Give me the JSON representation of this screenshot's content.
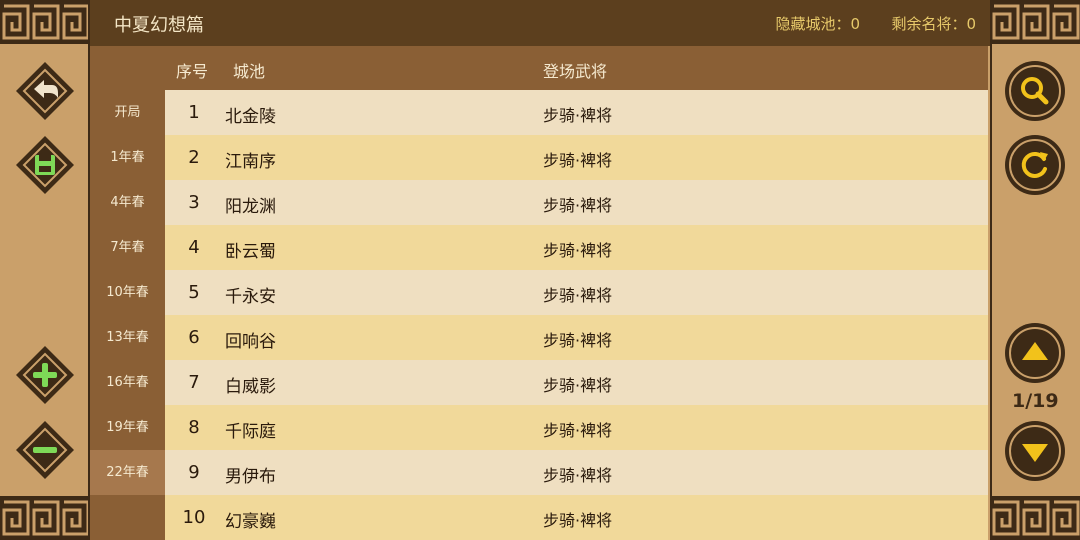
{
  "header": {
    "title": "中夏幻想篇",
    "hidden_cities": "隐藏城池：0",
    "remaining_generals": "剩余名将：0"
  },
  "table": {
    "columns": [
      "序号",
      "城池",
      "登场武将"
    ],
    "rows": [
      {
        "season": "开局",
        "num": "1",
        "city": "北金陵",
        "generals": "步骑·裨将"
      },
      {
        "season": "1年春",
        "num": "2",
        "city": "江南序",
        "generals": "步骑·裨将"
      },
      {
        "season": "4年春",
        "num": "3",
        "city": "阳龙渊",
        "generals": "步骑·裨将"
      },
      {
        "season": "7年春",
        "num": "4",
        "city": "卧云蜀",
        "generals": "步骑·裨将"
      },
      {
        "season": "10年春",
        "num": "5",
        "city": "千永安",
        "generals": "步骑·裨将"
      },
      {
        "season": "13年春",
        "num": "6",
        "city": "回响谷",
        "generals": "步骑·裨将"
      },
      {
        "season": "16年春",
        "num": "7",
        "city": "白威影",
        "generals": "步骑·裨将"
      },
      {
        "season": "19年春",
        "num": "8",
        "city": "千际庭",
        "generals": "步骑·裨将"
      },
      {
        "season": "22年春",
        "num": "9",
        "city": "男伊布",
        "generals": "步骑·裨将"
      },
      {
        "season": "",
        "num": "10",
        "city": "幻豪巍",
        "generals": "步骑·裨将"
      }
    ]
  },
  "pagination": {
    "page": "1/19"
  },
  "icons": {
    "back": "back-arrow-icon",
    "save": "save-icon",
    "add": "plus-icon",
    "remove": "minus-icon",
    "search": "search-icon",
    "refresh": "refresh-icon",
    "up": "up-triangle-icon",
    "down": "down-triangle-icon"
  },
  "colors": {
    "dark": "#3d2a16",
    "panel": "#caa06a",
    "topbar": "#5c3f1e",
    "header": "#8a5f35",
    "row_odd": "#efdfc1",
    "row_even": "#f1d99a",
    "gold": "#e7c96a",
    "accent_green": "#7ed957",
    "accent_yellow": "#f2c21b"
  }
}
